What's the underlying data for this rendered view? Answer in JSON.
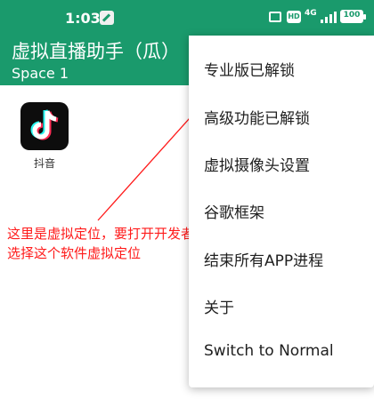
{
  "status_bar": {
    "time": "1:03",
    "hd_badge": "HD",
    "network": "4G",
    "battery": "100"
  },
  "app_bar": {
    "title": "虚拟直播助手（瓜）",
    "subtitle": "Space 1"
  },
  "apps": [
    {
      "label": "抖音",
      "icon": "tiktok-icon"
    }
  ],
  "menu": {
    "items": [
      {
        "label": "专业版已解锁"
      },
      {
        "label": "高级功能已解锁"
      },
      {
        "label": "虚拟摄像头设置"
      },
      {
        "label": "谷歌框架"
      },
      {
        "label": "结束所有APP进程"
      },
      {
        "label": "关于"
      },
      {
        "label": "Switch to Normal"
      }
    ]
  },
  "annotation": {
    "line1": "这里是虚拟定位，要打开开发者模式",
    "line2": "选择这个软件虚拟定位",
    "color": "#ff1a1a"
  },
  "colors": {
    "brand": "#1a9a6c"
  }
}
